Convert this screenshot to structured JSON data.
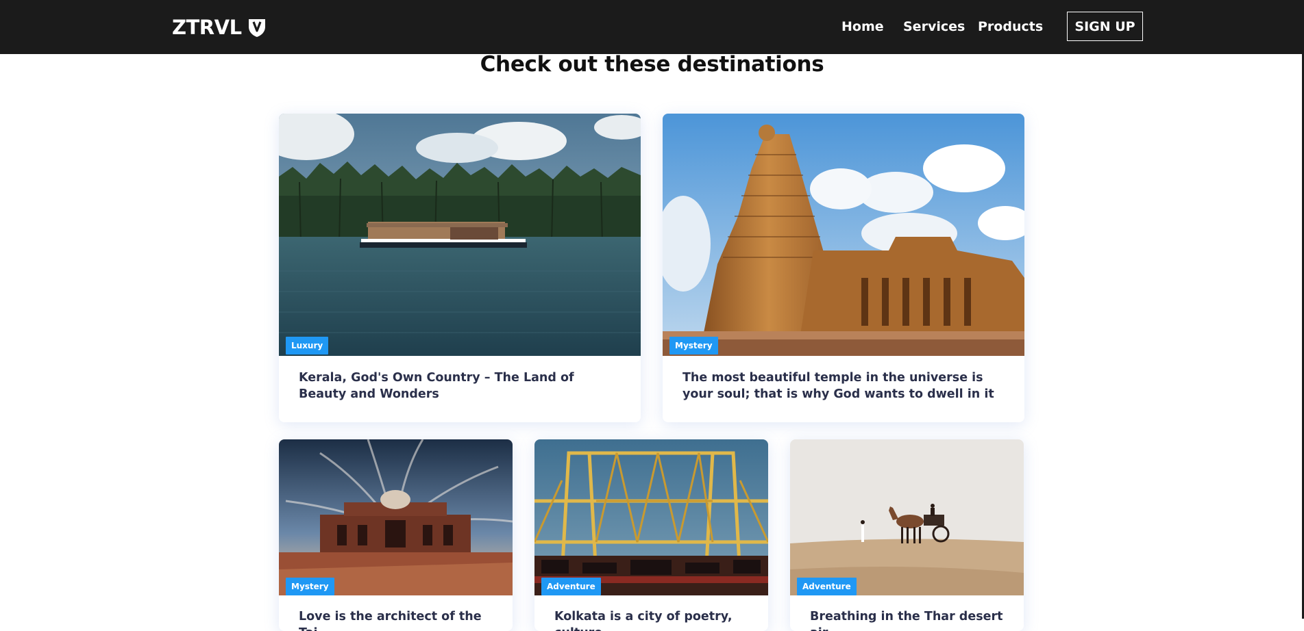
{
  "brand": {
    "name": "ZTRVL",
    "logo_icon": "shield-v-icon"
  },
  "nav": {
    "items": [
      {
        "label": "Home"
      },
      {
        "label": "Services"
      },
      {
        "label": "Products"
      }
    ],
    "signup_label": "SIGN UP"
  },
  "main": {
    "heading": "Check out these destinations",
    "cards": [
      {
        "tag": "Luxury",
        "title": "Kerala, God's Own Country – The Land of Beauty and Wonders",
        "image": "houseboat-backwaters-photo"
      },
      {
        "tag": "Mystery",
        "title": "The most beautiful temple in the universe is your soul; that is why God wants to dwell in it",
        "image": "temple-tower-photo"
      },
      {
        "tag": "Mystery",
        "title": "Love is the architect of the Taj",
        "image": "tomb-sunset-photo"
      },
      {
        "tag": "Adventure",
        "title": "Kolkata is a city of poetry, culture",
        "image": "howrah-bridge-photo"
      },
      {
        "tag": "Adventure",
        "title": "Breathing in the Thar desert air",
        "image": "camel-desert-photo"
      }
    ]
  },
  "colors": {
    "navbar_bg": "#1b1b1b",
    "badge_bg": "#1f98f4",
    "title_text": "#2a2f4a"
  }
}
